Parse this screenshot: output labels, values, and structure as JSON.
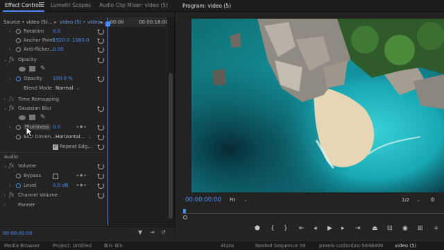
{
  "effect_controls": {
    "tabs": [
      {
        "label": "Effect Controls",
        "active": true
      },
      {
        "label": "Lumetri Scopes",
        "active": false
      },
      {
        "label": "Audio Clip Mixer: video (5)",
        "active": false
      }
    ],
    "source_label": "Source • video (5)...",
    "clip_label": "video (5) • video...",
    "ruler_start": ":00:00",
    "ruler_end": "00:00:16:00",
    "motion": {
      "rotation_label": "Rotation",
      "rotation_value": "0.0",
      "anchor_label": "Anchor Point",
      "anchor_x": "1920.0",
      "anchor_y": "1080.0",
      "antiflicker_label": "Anti-flicker...",
      "antiflicker_value": "0.00"
    },
    "opacity": {
      "section_label": "Opacity",
      "opacity_label": "Opacity",
      "opacity_value": "100.0 %",
      "blend_label": "Blend Mode",
      "blend_value": "Normal"
    },
    "time_remapping_label": "Time Remapping",
    "gaussian_blur": {
      "section_label": "Gaussian Blur",
      "blurriness_label": "Blurriness",
      "blurriness_value": "0.0",
      "dimensions_label": "Blur Dimen...",
      "dimensions_value": "Horizontal...",
      "repeat_edge_label": "Repeat Edg..."
    },
    "audio": {
      "section_label": "Audio",
      "volume_label": "Volume",
      "bypass_label": "Bypass",
      "level_label": "Level",
      "level_value": "0.0 dB",
      "channel_volume_label": "Channel Volume",
      "panner_label": "Panner"
    },
    "timecode": "00:00:00:00"
  },
  "program_monitor": {
    "title": "Program: video (5)",
    "timecode": "00:00:00:00",
    "fit_label": "Fit",
    "resolution_label": "1/2"
  },
  "bottom_tabs": [
    {
      "label": "Media Browser",
      "active": false
    },
    {
      "label": "Project: Untitled",
      "active": false
    },
    {
      "label": "Bin: Bin",
      "active": false
    },
    {
      "label": "4tans",
      "active": false
    },
    {
      "label": "Nested Sequence 09",
      "active": false
    },
    {
      "label": "pexels-cottonbro-5648490",
      "active": false
    },
    {
      "label": "video (5)",
      "active": true
    }
  ],
  "colors": {
    "accent": "#4a8dff",
    "value_blue": "#4d8ef7",
    "panel_bg": "#232323"
  }
}
